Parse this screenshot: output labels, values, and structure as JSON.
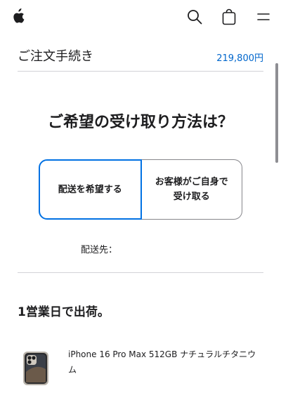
{
  "nav": {
    "logo": "apple-logo-icon",
    "icons": [
      "search-icon",
      "bag-icon",
      "menu-icon"
    ]
  },
  "summary": {
    "title": "ご注文手続き",
    "total": "219,800円"
  },
  "delivery": {
    "headline": "ご希望の受け取り方法は？",
    "options": [
      {
        "label": "配送を希望する",
        "selected": true
      },
      {
        "label": "お客様がご自身で受け取る",
        "selected": false
      }
    ],
    "destination_label": "配送先："
  },
  "shipping": {
    "heading": "1営業日で出荷。",
    "product": {
      "name": "iPhone 16 Pro Max 512GB ナチュラルチタニウム",
      "image": "iphone-product-image"
    }
  },
  "colors": {
    "accent": "#0071e3",
    "link": "#0066cc",
    "text": "#1d1d1f",
    "divider": "#d2d2d7"
  }
}
